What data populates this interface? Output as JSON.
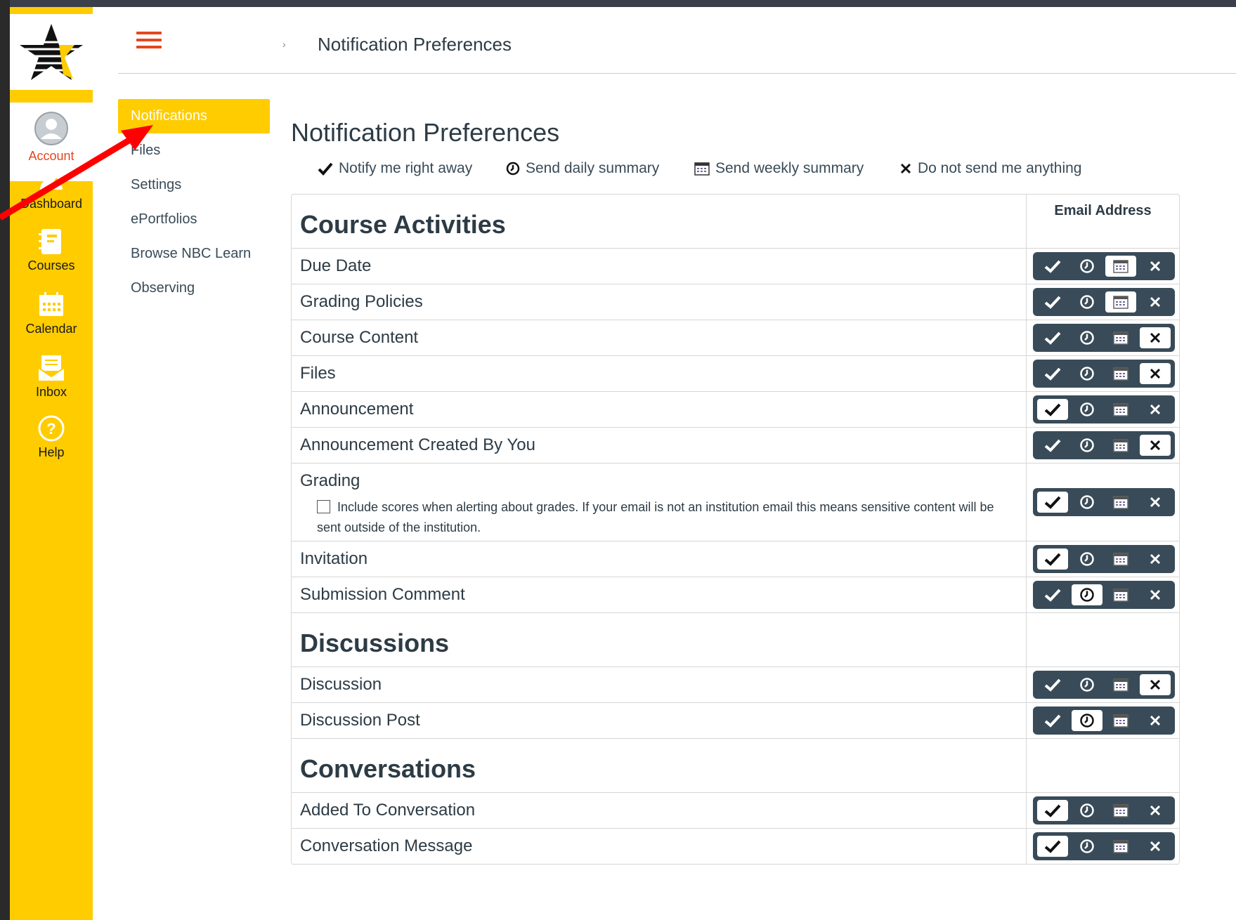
{
  "global_nav": {
    "items": [
      {
        "label": "Account",
        "icon": "account-icon"
      },
      {
        "label": "Dashboard",
        "icon": "dashboard-icon"
      },
      {
        "label": "Courses",
        "icon": "courses-icon"
      },
      {
        "label": "Calendar",
        "icon": "calendar-icon"
      },
      {
        "label": "Inbox",
        "icon": "inbox-icon"
      },
      {
        "label": "Help",
        "icon": "help-icon"
      }
    ]
  },
  "breadcrumb": {
    "current": "Notification Preferences"
  },
  "subnav": {
    "items": [
      {
        "label": "Notifications",
        "active": true
      },
      {
        "label": "Files"
      },
      {
        "label": "Settings"
      },
      {
        "label": "ePortfolios"
      },
      {
        "label": "Browse NBC Learn"
      },
      {
        "label": "Observing"
      }
    ]
  },
  "page": {
    "title": "Notification Preferences",
    "legend": {
      "right_away": "Notify me right away",
      "daily": "Send daily summary",
      "weekly": "Send weekly summary",
      "never": "Do not send me anything"
    },
    "column_header": "Email Address"
  },
  "sections": [
    {
      "title": "Course Activities",
      "rows": [
        {
          "label": "Due Date",
          "selected": "weekly"
        },
        {
          "label": "Grading Policies",
          "selected": "weekly"
        },
        {
          "label": "Course Content",
          "selected": "never"
        },
        {
          "label": "Files",
          "selected": "never"
        },
        {
          "label": "Announcement",
          "selected": "right_away"
        },
        {
          "label": "Announcement Created By You",
          "selected": "never"
        },
        {
          "label": "Grading",
          "selected": "right_away",
          "extra": "Include scores when alerting about grades. If your email is not an institution email this means sensitive content will be sent outside of the institution."
        },
        {
          "label": "Invitation",
          "selected": "right_away"
        },
        {
          "label": "Submission Comment",
          "selected": "daily"
        }
      ]
    },
    {
      "title": "Discussions",
      "rows": [
        {
          "label": "Discussion",
          "selected": "never"
        },
        {
          "label": "Discussion Post",
          "selected": "daily"
        }
      ]
    },
    {
      "title": "Conversations",
      "rows": [
        {
          "label": "Added To Conversation",
          "selected": "right_away"
        },
        {
          "label": "Conversation Message",
          "selected": "right_away"
        }
      ]
    }
  ],
  "colors": {
    "nav": "#ffcc00",
    "accent": "#e5461f",
    "toggle": "#394b58",
    "annotation_arrow": "#ff0000"
  }
}
